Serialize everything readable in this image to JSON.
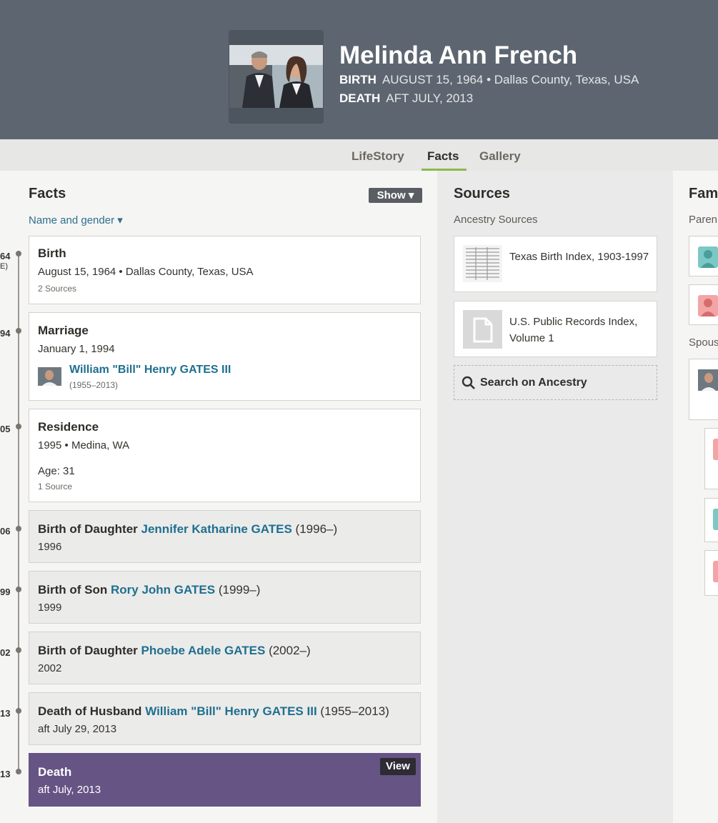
{
  "profile": {
    "name": "Melinda Ann French",
    "birth_label": "BIRTH",
    "birth_value": "AUGUST 15, 1964 • Dallas County, Texas, USA",
    "death_label": "DEATH",
    "death_value": "AFT JULY, 2013"
  },
  "tabs": [
    {
      "label": "LifeStory",
      "active": false
    },
    {
      "label": "Facts",
      "active": true
    },
    {
      "label": "Gallery",
      "active": false
    }
  ],
  "facts": {
    "title": "Facts",
    "show_button": "Show",
    "filter_link": "Name and gender",
    "timeline_years": [
      "64",
      "E)",
      "94",
      "05",
      "06",
      "99",
      "02",
      "13",
      "13"
    ],
    "items": [
      {
        "title": "Birth",
        "line1": "August 15, 1964 • Dallas County, Texas, USA",
        "sources": "2 Sources"
      },
      {
        "title": "Marriage",
        "line1": "January 1, 1994",
        "spouse_name": "William \"Bill\" Henry GATES III",
        "spouse_years": "(1955–2013)"
      },
      {
        "title": "Residence",
        "line1": "1995 • Medina, WA",
        "age": "Age: 31",
        "sources": "1 Source"
      },
      {
        "prefix": "Birth of Daughter",
        "link": "Jennifer Katharine GATES",
        "suffix": "(1996–)",
        "line1": "1996"
      },
      {
        "prefix": "Birth of Son",
        "link": "Rory John GATES",
        "suffix": "(1999–)",
        "line1": "1999"
      },
      {
        "prefix": "Birth of Daughter",
        "link": "Phoebe Adele GATES",
        "suffix": "(2002–)",
        "line1": "2002"
      },
      {
        "prefix": "Death of Husband",
        "link": "William \"Bill\" Henry GATES III",
        "suffix": "(1955–2013)",
        "line1": "aft July 29, 2013"
      },
      {
        "title": "Death",
        "line1": "aft July, 2013",
        "view_button": "View"
      }
    ]
  },
  "sources": {
    "title": "Sources",
    "subtitle": "Ancestry Sources",
    "items": [
      {
        "text": "Texas Birth Index, 1903-1997"
      },
      {
        "text": "U.S. Public Records Index, Volume 1"
      }
    ],
    "search_label": "Search on Ancestry"
  },
  "family": {
    "title": "Fam",
    "parents_label": "Paren",
    "spouse_label": "Spous"
  },
  "colors": {
    "header_bg": "#5d6670",
    "link": "#1f6f8f",
    "death_card": "#655484",
    "tab_underline": "#8cb84f"
  }
}
